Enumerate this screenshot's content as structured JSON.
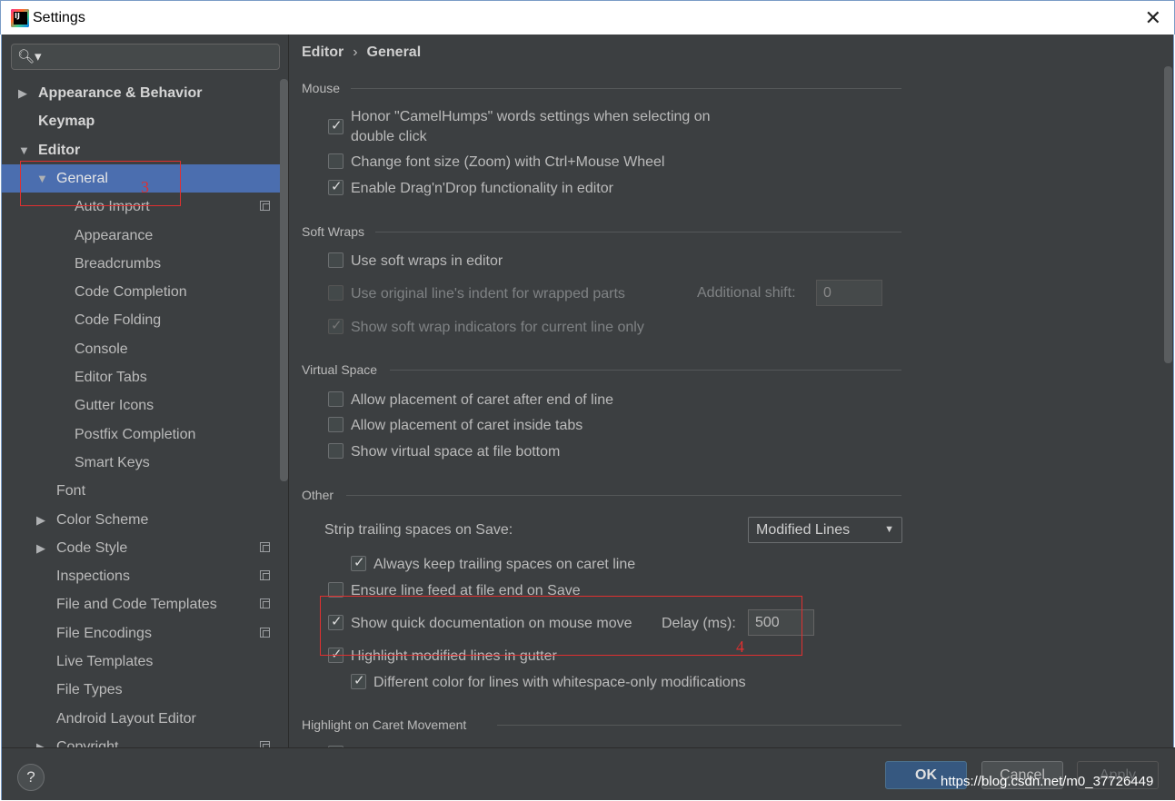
{
  "window": {
    "title": "Settings",
    "close_glyph": "✕"
  },
  "search": {
    "icon": "search-icon",
    "glyph": "🔍︎▾",
    "placeholder": ""
  },
  "tree": [
    {
      "label": "Appearance & Behavior",
      "bold": true,
      "arrow": "▶"
    },
    {
      "label": "Keymap",
      "bold": true
    },
    {
      "label": "Editor",
      "bold": true,
      "arrow": "▼"
    },
    {
      "label": "General",
      "arrow": "▼",
      "selected": true
    },
    {
      "label": "Auto Import",
      "project_icon": true
    },
    {
      "label": "Appearance"
    },
    {
      "label": "Breadcrumbs"
    },
    {
      "label": "Code Completion"
    },
    {
      "label": "Code Folding"
    },
    {
      "label": "Console"
    },
    {
      "label": "Editor Tabs"
    },
    {
      "label": "Gutter Icons"
    },
    {
      "label": "Postfix Completion"
    },
    {
      "label": "Smart Keys"
    },
    {
      "label": "Font"
    },
    {
      "label": "Color Scheme",
      "arrow": "▶"
    },
    {
      "label": "Code Style",
      "arrow": "▶",
      "project_icon": true
    },
    {
      "label": "Inspections",
      "project_icon": true
    },
    {
      "label": "File and Code Templates",
      "project_icon": true
    },
    {
      "label": "File Encodings",
      "project_icon": true
    },
    {
      "label": "Live Templates"
    },
    {
      "label": "File Types"
    },
    {
      "label": "Android Layout Editor"
    },
    {
      "label": "Copyright",
      "arrow": "▶",
      "project_icon": true
    }
  ],
  "breadcrumb": {
    "first": "Editor",
    "separator": "›",
    "second": "General"
  },
  "sections": {
    "mouse": "Mouse",
    "soft_wraps": "Soft Wraps",
    "virtual_space": "Virtual Space",
    "other": "Other",
    "caret": "Highlight on Caret Movement"
  },
  "mouse": {
    "camelhumps_line1": "Honor \"CamelHumps\" words settings when selecting on",
    "camelhumps_line2": "double click",
    "camelhumps_checked": true,
    "zoom": "Change font size (Zoom) with Ctrl+Mouse Wheel",
    "zoom_checked": false,
    "dnd": "Enable Drag'n'Drop functionality in editor",
    "dnd_checked": true
  },
  "soft_wraps": {
    "use": "Use soft wraps in editor",
    "use_checked": false,
    "indent": "Use original line's indent for wrapped parts",
    "indent_checked": false,
    "shift_label": "Additional shift:",
    "shift_value": "0",
    "indicators": "Show soft wrap indicators for current line only",
    "indicators_checked": true
  },
  "virtual_space": {
    "after_eol": "Allow placement of caret after end of line",
    "inside_tabs": "Allow placement of caret inside tabs",
    "file_bottom": "Show virtual space at file bottom"
  },
  "other": {
    "strip_label": "Strip trailing spaces on Save:",
    "strip_value": "Modified Lines",
    "keep_trailing": "Always keep trailing spaces on caret line",
    "keep_trailing_checked": true,
    "line_feed": "Ensure line feed at file end on Save",
    "line_feed_checked": false,
    "quick_doc": "Show quick documentation on mouse move",
    "quick_doc_checked": true,
    "delay_label": "Delay (ms):",
    "delay_value": "500",
    "highlight_modified": "Highlight modified lines in gutter",
    "highlight_modified_checked": true,
    "whitespace_color": "Different color for lines with whitespace-only modifications",
    "whitespace_color_checked": true
  },
  "annotations": {
    "tree_marker": "3",
    "option_marker": "4",
    "color": "#e03030"
  },
  "buttons": {
    "help": "?",
    "ok": "OK",
    "cancel": "Cancel",
    "apply": "Apply"
  },
  "watermark": "https://blog.csdn.net/m0_37726449",
  "colors": {
    "background": "#3c3f41",
    "selection": "#4b6eaf",
    "ok_button": "#365880"
  }
}
